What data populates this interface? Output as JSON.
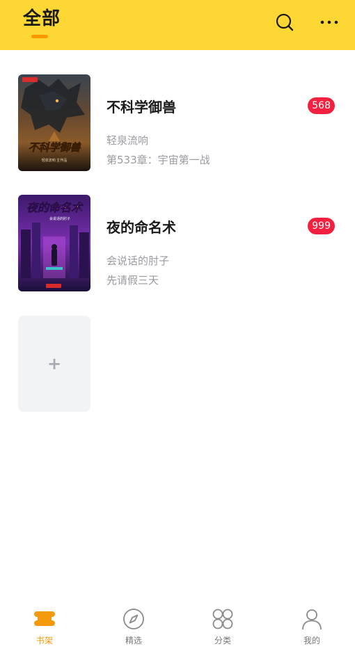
{
  "header": {
    "title": "全部",
    "accent_color": "#FF9800",
    "background_color": "#FDD835",
    "search_icon": "search-icon",
    "more_icon": "more-dots-icon"
  },
  "books": [
    {
      "title": "不科学御兽",
      "badge": "568",
      "author": "轻泉流响",
      "latest_chapter": "第533章：宇宙第一战",
      "cover_text": "不科学御兽",
      "cover_sub": "轻泉流响 主作品"
    },
    {
      "title": "夜的命名术",
      "badge": "999",
      "author": "会说话的肘子",
      "latest_chapter": "先请假三天",
      "cover_text": "夜的命名术",
      "cover_sub": "会说话的肘子"
    }
  ],
  "add_card": {
    "symbol": "+"
  },
  "tabbar": {
    "active_color": "#F59A0C",
    "items": [
      {
        "label": "书架",
        "icon": "bookshelf-icon",
        "active": true
      },
      {
        "label": "精选",
        "icon": "compass-icon",
        "active": false
      },
      {
        "label": "分类",
        "icon": "category-grid-icon",
        "active": false
      },
      {
        "label": "我的",
        "icon": "user-icon",
        "active": false
      }
    ]
  }
}
